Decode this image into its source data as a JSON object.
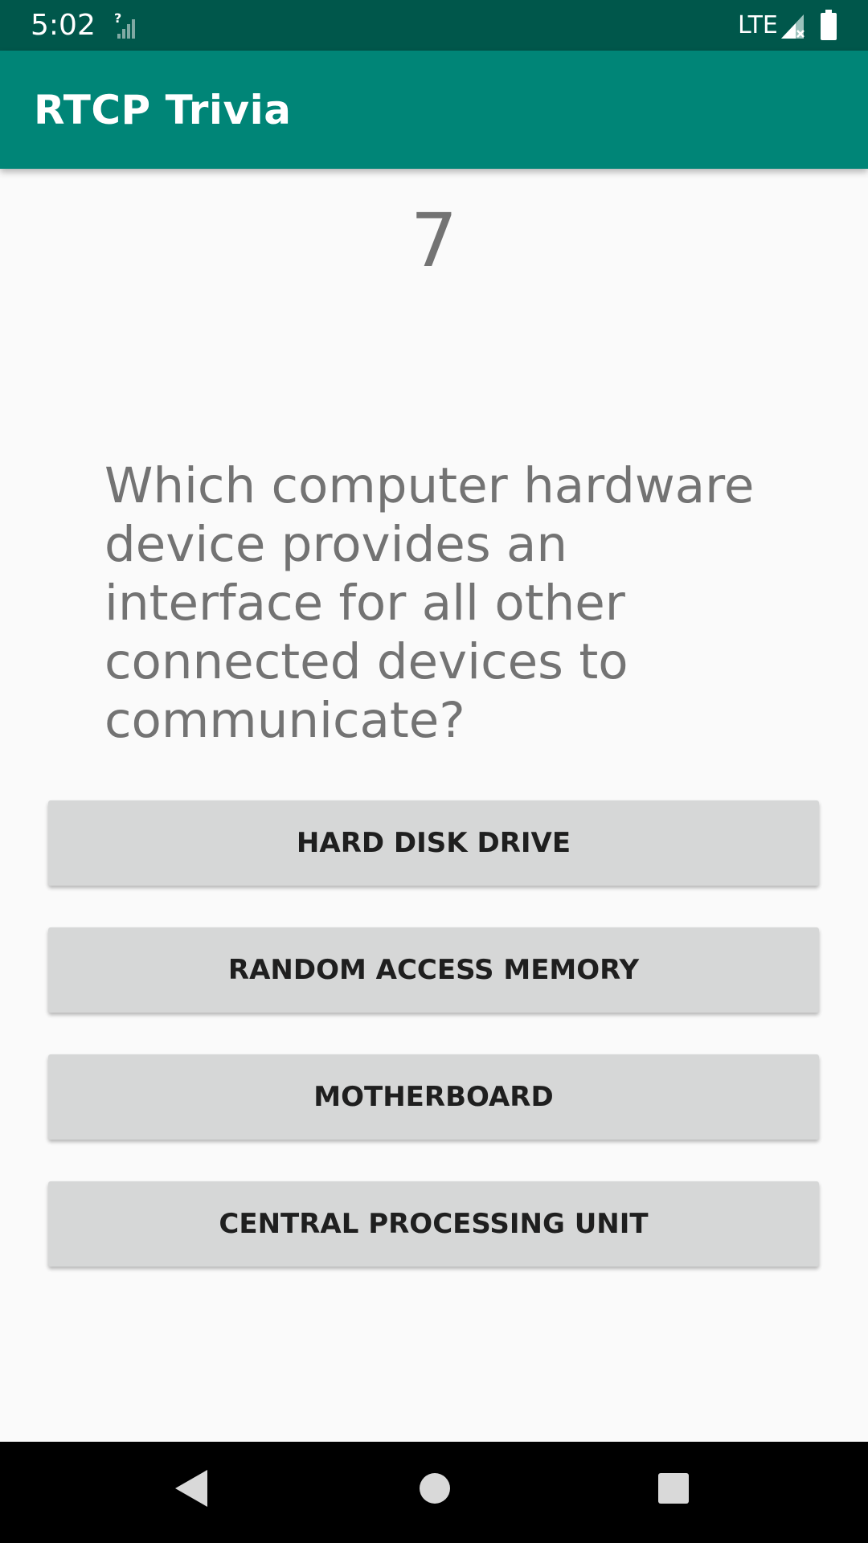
{
  "status_bar": {
    "time": "5:02",
    "signal_mark": "?",
    "network": "LTE",
    "icons": [
      "wifi-unknown-icon",
      "cell-signal-icon",
      "battery-icon"
    ]
  },
  "app_bar": {
    "title": "RTCP Trivia",
    "color": "#008577"
  },
  "quiz": {
    "question_number": "7",
    "question": "Which computer hardware device provides an interface for all other connected devices to communicate?",
    "answers": [
      {
        "label": "HARD DISK DRIVE"
      },
      {
        "label": "RANDOM ACCESS MEMORY"
      },
      {
        "label": "MOTHERBOARD"
      },
      {
        "label": "CENTRAL PROCESSING UNIT"
      }
    ]
  },
  "nav_bar": {
    "icons": [
      "back-icon",
      "home-icon",
      "recents-icon"
    ]
  }
}
